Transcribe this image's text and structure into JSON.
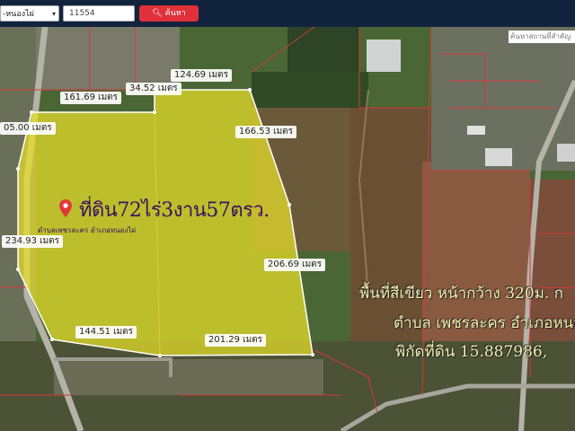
{
  "search": {
    "district_select": "-หนองไผ่",
    "query": "11554",
    "button_label": "ค้นหา",
    "top_right_placeholder": "ค้นหาสถานที่สำคัญ"
  },
  "plot": {
    "title": "ที่ดิน72ไร่3งาน57ตรว.",
    "pin_subtitle": "ตำบลเพชรละคร อำเภอหนองไผ่",
    "highlight_color": "#e9e02a"
  },
  "measurements": {
    "m1": "124.69 เมตร",
    "m2": "34.52 เมตร",
    "m3": "161.69 เมตร",
    "m4": "166.53 เมตร",
    "m5": "05.00 เมตร",
    "m6": "234.93 เมตร",
    "m7": "206.69 เมตร",
    "m8": "144.51 เมตร",
    "m9": "201.29 เมตร"
  },
  "description": {
    "line1": "พื้นที่สีเขียว หน้ากว้าง 320ม. ก",
    "line2": "ตำบล เพชรละคร อำเภอหนอ",
    "line3": "พิกัดที่ดิน 15.887986,"
  }
}
